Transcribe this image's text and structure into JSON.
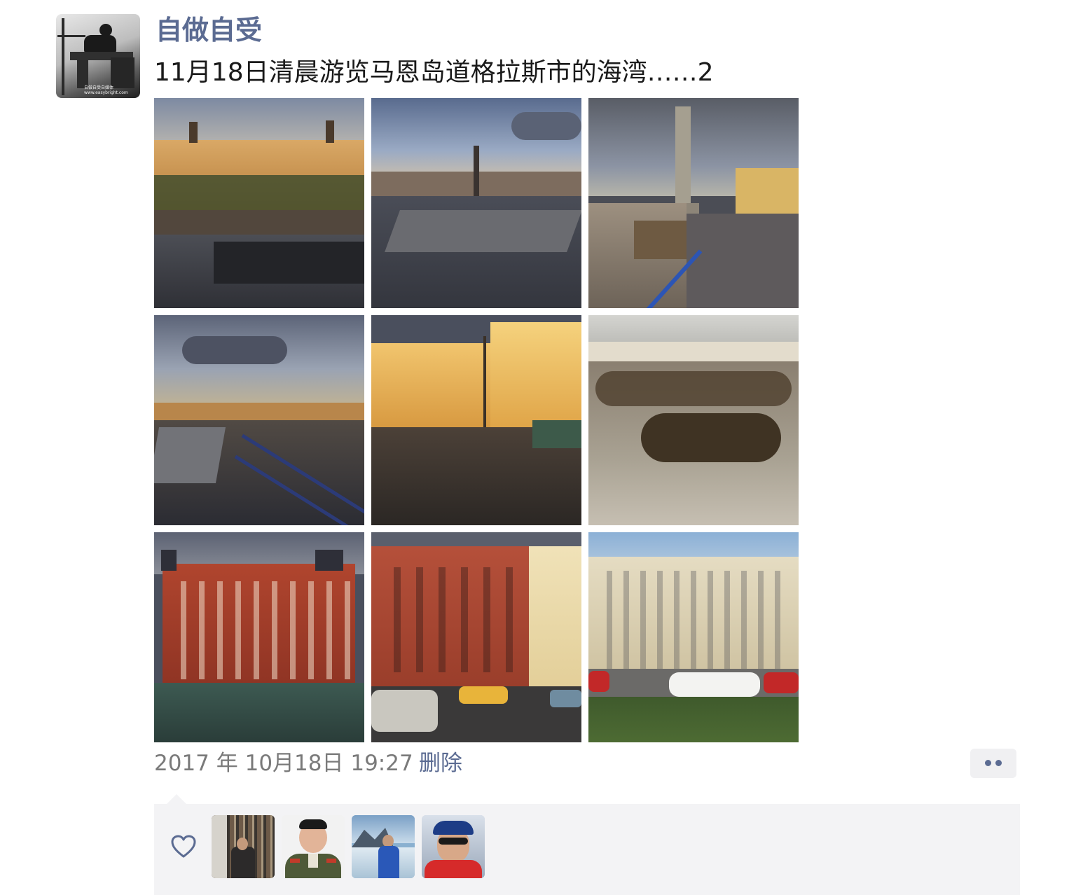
{
  "post": {
    "author": "自做自受",
    "caption": "11月18日清晨游览马恩岛道格拉斯市的海湾……2",
    "timestamp": "2017 年 10月18日 19:27",
    "delete_label": "删除",
    "avatar_caption_line1": "自做自受自媒体",
    "avatar_caption_line2": "www.easybright.com"
  },
  "photos": [
    {
      "name": "photo-hotel-facade-sunset",
      "subject": "hotel facade at sunset"
    },
    {
      "name": "photo-promenade-monument",
      "subject": "promenade with monument"
    },
    {
      "name": "photo-war-memorial-column",
      "subject": "memorial column on seafront"
    },
    {
      "name": "photo-railing-stormy-sky",
      "subject": "seafront railing, stormy sky"
    },
    {
      "name": "photo-golden-building",
      "subject": "golden lit building"
    },
    {
      "name": "photo-beach-seaweed",
      "subject": "beach with seaweed"
    },
    {
      "name": "photo-red-brick-hotel",
      "subject": "red brick hotel"
    },
    {
      "name": "photo-red-terrace-street",
      "subject": "red brick terrace and cars"
    },
    {
      "name": "photo-cream-hotel-cars",
      "subject": "cream hotel with parked cars"
    }
  ],
  "likes": {
    "icon": "heart-icon",
    "likers": [
      {
        "name": "liker-bookshelf",
        "subject": "man in front of bookshelf"
      },
      {
        "name": "liker-uniform",
        "subject": "man in green uniform"
      },
      {
        "name": "liker-glacier",
        "subject": "man near glacier"
      },
      {
        "name": "liker-cap",
        "subject": "man in cap and red jacket"
      }
    ]
  },
  "colors": {
    "link": "#5b6b92",
    "likes_bg": "#f3f3f5",
    "timestamp": "#7a7a7a"
  }
}
